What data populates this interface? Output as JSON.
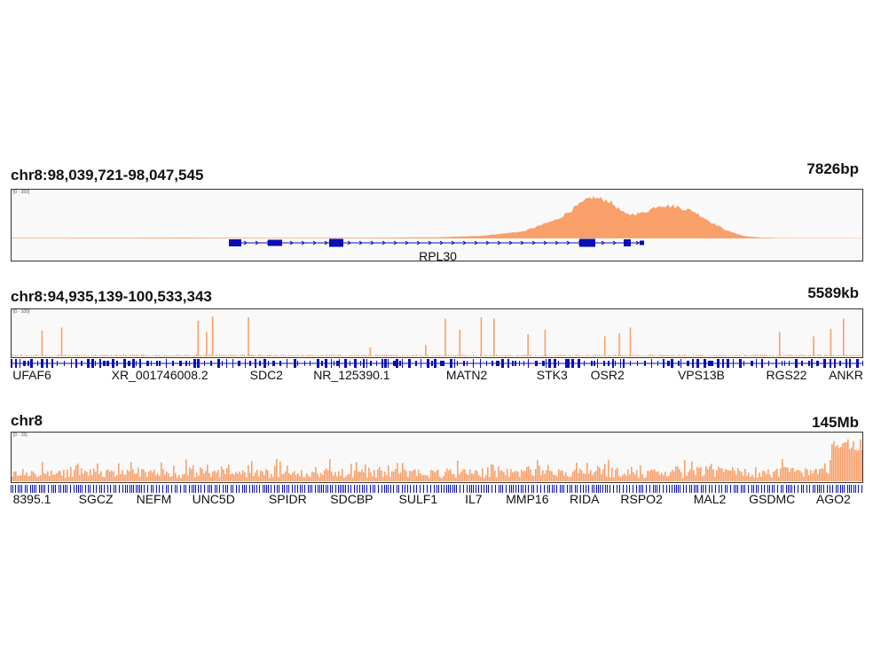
{
  "colors": {
    "signal": "#F9A06A",
    "gene": "#0A0FB4",
    "frame": "#333333",
    "background": "#F9F9F9"
  },
  "chart_data": [
    {
      "type": "area",
      "region": "chr8:98,039,721-98,047,545",
      "span": "7826bp",
      "scale_label": "[0 - 350]",
      "x_range": [
        98039721,
        98047545
      ],
      "ylim": [
        0,
        350
      ],
      "signal": {
        "x": [
          0,
          0.1,
          0.2,
          0.3,
          0.4,
          0.5,
          0.55,
          0.6,
          0.64,
          0.66,
          0.68,
          0.7,
          0.72,
          0.74,
          0.76,
          0.78,
          0.8,
          0.82,
          0.84,
          0.86,
          0.88,
          0.9,
          1.0
        ],
        "y": [
          4,
          5,
          7,
          4,
          5,
          9,
          20,
          55,
          150,
          240,
          325,
          300,
          190,
          200,
          265,
          250,
          215,
          130,
          60,
          18,
          6,
          3,
          3
        ]
      },
      "genes": [
        {
          "name": "RPL30",
          "label_pos": 0.5
        }
      ]
    },
    {
      "type": "bar",
      "region": "chr8:94,935,139-100,533,343",
      "span": "5589kb",
      "scale_label": "[0 - 100]",
      "x_range": [
        94935139,
        100533343
      ],
      "ylim": [
        0,
        100
      ],
      "peaks": {
        "x": [
          0.035,
          0.058,
          0.218,
          0.228,
          0.235,
          0.277,
          0.42,
          0.485,
          0.508,
          0.525,
          0.55,
          0.565,
          0.605,
          0.625,
          0.695,
          0.712,
          0.725,
          0.9,
          0.94,
          0.96,
          0.975
        ],
        "y": [
          58,
          65,
          80,
          55,
          90,
          88,
          20,
          25,
          85,
          60,
          88,
          85,
          50,
          60,
          45,
          52,
          65,
          55,
          45,
          62,
          85
        ]
      },
      "genes": [
        "UFAF6",
        "XR_001746008.2",
        "SDC2",
        "NR_125390.1",
        "MATN2",
        "STK3",
        "OSR2",
        "VPS13B",
        "RGS22",
        "ANKRD"
      ],
      "gene_positions": [
        0.025,
        0.175,
        0.3,
        0.4,
        0.535,
        0.635,
        0.7,
        0.81,
        0.91,
        0.985
      ]
    },
    {
      "type": "bar",
      "region": "chr8",
      "span": "145Mb",
      "scale_label": "[0 - 15]",
      "x_range": [
        0,
        145000000
      ],
      "ylim": [
        0,
        15
      ],
      "genes": [
        "8395.1",
        "SGCZ",
        "NEFM",
        "UNC5D",
        "SPIDR",
        "SDCBP",
        "SULF1",
        "IL7",
        "MMP16",
        "RIDA",
        "RSPO2",
        "MAL2",
        "GSDMC",
        "AGO2"
      ],
      "gene_positions": [
        0.025,
        0.1,
        0.168,
        0.238,
        0.325,
        0.4,
        0.478,
        0.543,
        0.606,
        0.673,
        0.74,
        0.82,
        0.893,
        0.965
      ]
    }
  ]
}
